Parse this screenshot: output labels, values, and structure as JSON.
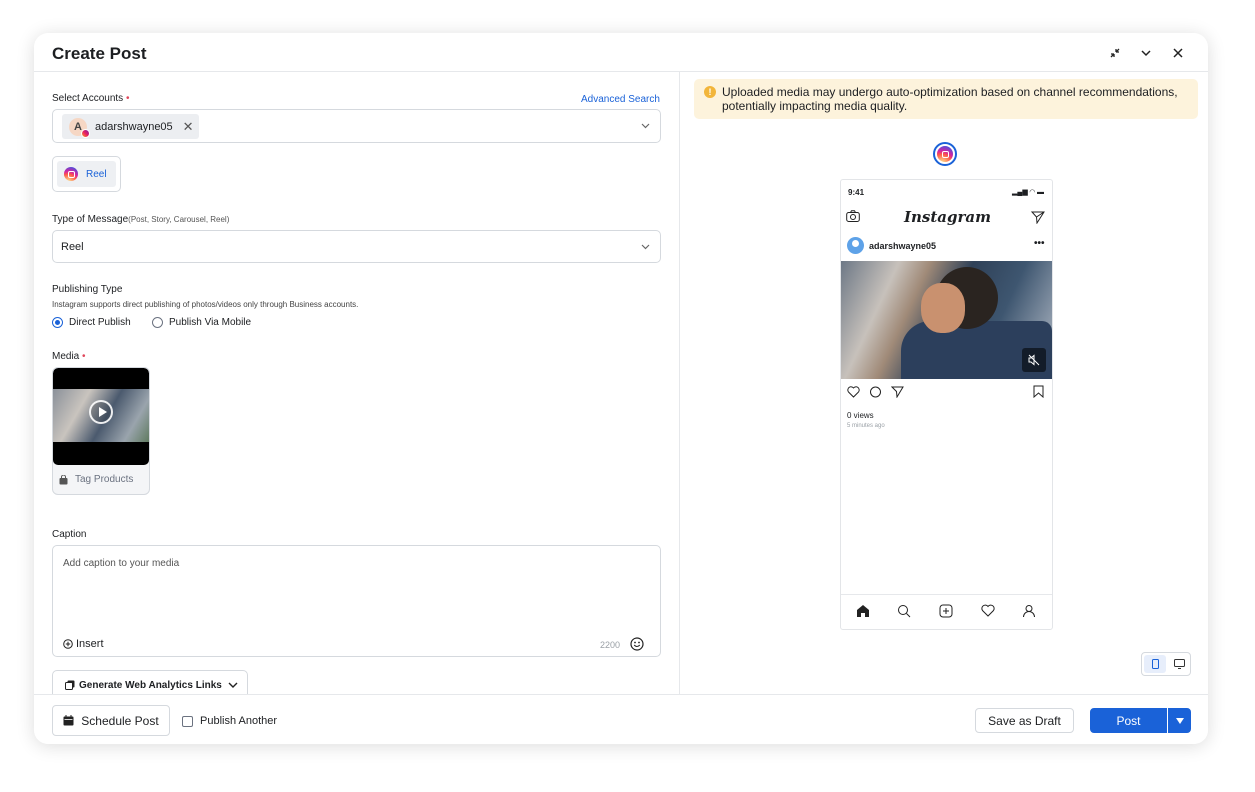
{
  "header": {
    "title": "Create Post"
  },
  "accounts": {
    "label": "Select Accounts",
    "required_mark": "•",
    "advanced_search": "Advanced Search",
    "selected": [
      {
        "initial": "A",
        "name": "adarshwayne05"
      }
    ]
  },
  "channel_tab": {
    "label": "Reel"
  },
  "message_type": {
    "label": "Type of Message",
    "hint": "(Post, Story, Carousel, Reel)",
    "value": "Reel"
  },
  "publishing": {
    "label": "Publishing Type",
    "description": "Instagram supports direct publishing of photos/videos only through Business accounts.",
    "options": [
      {
        "label": "Direct Publish",
        "selected": true
      },
      {
        "label": "Publish Via Mobile",
        "selected": false
      }
    ]
  },
  "media": {
    "label": "Media",
    "required_mark": "•",
    "tag_products": "Tag Products"
  },
  "caption": {
    "label": "Caption",
    "placeholder": "Add caption to your media",
    "insert": "Insert",
    "char_limit": "2200"
  },
  "analytics_button": "Generate Web Analytics Links",
  "footer": {
    "schedule": "Schedule Post",
    "publish_another": "Publish Another",
    "save_draft": "Save as Draft",
    "post": "Post"
  },
  "preview": {
    "warning": "Uploaded media may undergo auto-optimization based on channel recommendations, potentially impacting media quality.",
    "phone": {
      "time": "9:41",
      "brand": "Instagram",
      "username": "adarshwayne05",
      "views": "0 views",
      "time_ago": "5 minutes ago"
    }
  },
  "colors": {
    "accent": "#1a62d8",
    "warning_bg": "#fdf3dc",
    "required": "#e0475b"
  }
}
